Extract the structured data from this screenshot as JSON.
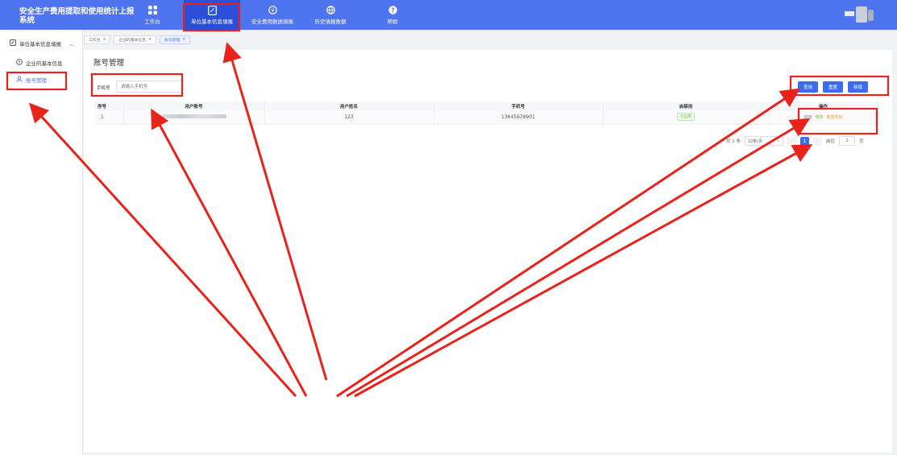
{
  "app": {
    "title": "安全生产费用提取和使用统计上报系统"
  },
  "nav": {
    "items": [
      {
        "label": "工作台",
        "icon": "grid-icon"
      },
      {
        "label": "单位基本信息填报",
        "icon": "edit-form-icon"
      },
      {
        "label": "安全费用数据填报",
        "icon": "money-icon"
      },
      {
        "label": "历史填报数据",
        "icon": "globe-icon"
      },
      {
        "label": "帮助",
        "icon": "help-icon"
      }
    ]
  },
  "sidebar": {
    "group_label": "单位基本信息填报",
    "items": [
      {
        "label": "企业的基本信息",
        "icon": "info-icon"
      },
      {
        "label": "账号管理",
        "icon": "user-icon"
      }
    ]
  },
  "tags": [
    {
      "label": "工作台"
    },
    {
      "label": "企业的基本信息"
    },
    {
      "label": "账号管理"
    }
  ],
  "page": {
    "title": "账号管理"
  },
  "search": {
    "label": "手机号",
    "placeholder": "请输入手机号"
  },
  "buttons": {
    "query": "查询",
    "reset": "重置",
    "add": "新增"
  },
  "table": {
    "headers": [
      "序号",
      "用户账号",
      "用户姓名",
      "手机号",
      "启禁用",
      "操作"
    ],
    "rows": [
      {
        "index": "1",
        "account": "",
        "name": "123",
        "phone": "13645678901",
        "status": "已启用",
        "ops": {
          "disable": "禁用",
          "edit": "修改",
          "reset_password": "重置密码"
        }
      }
    ]
  },
  "pagination": {
    "total_text": "共 1 条",
    "page_size": "10条/页",
    "prev": "‹",
    "current": "1",
    "next": "›",
    "goto_label": "前往",
    "goto_value": "1",
    "page_unit": "页"
  },
  "colors": {
    "brand": "#4f74f0",
    "nav_active": "#2b4fd8",
    "button": "#3d6cf0",
    "annotation": "#e8231c"
  }
}
